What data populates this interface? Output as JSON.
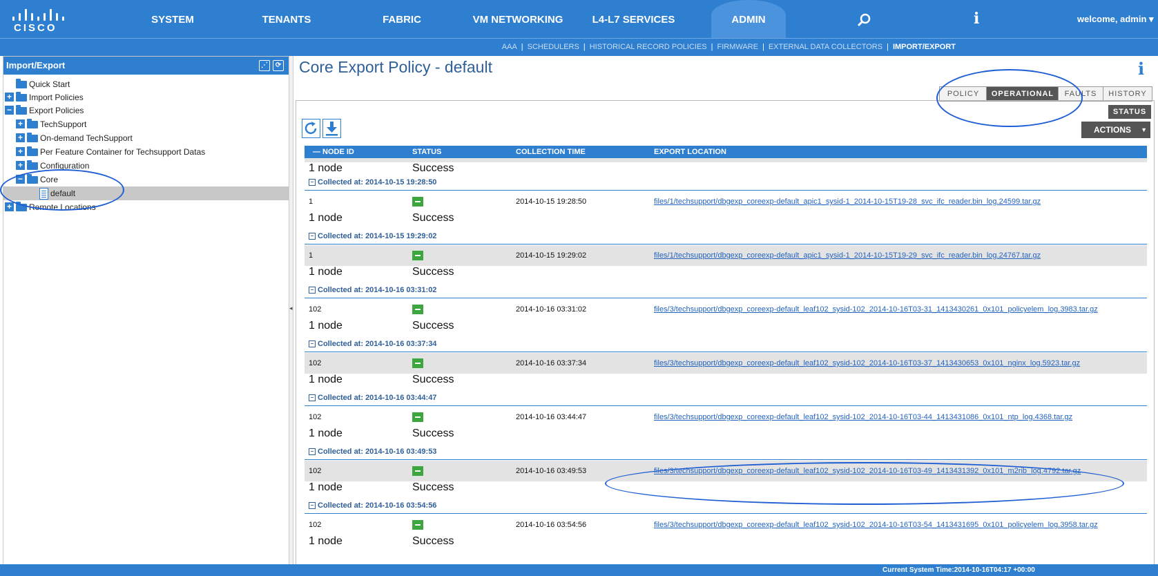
{
  "brand": "CISCO",
  "nav": [
    "SYSTEM",
    "TENANTS",
    "FABRIC",
    "VM NETWORKING",
    "L4-L7 SERVICES",
    "ADMIN"
  ],
  "welcome": "welcome, admin ▾",
  "subnav": [
    "AAA",
    "SCHEDULERS",
    "HISTORICAL RECORD POLICIES",
    "FIRMWARE",
    "EXTERNAL DATA COLLECTORS",
    "IMPORT/EXPORT"
  ],
  "left_panel": {
    "title": "Import/Export",
    "tree": [
      "Quick Start",
      "Import Policies",
      "Export Policies",
      "TechSupport",
      "On-demand TechSupport",
      "Per Feature Container for Techsupport Datas",
      "Configuration",
      "Core",
      "default",
      "Remote Locations"
    ]
  },
  "page_title": "Core Export Policy - default",
  "tabs": [
    "POLICY",
    "OPERATIONAL",
    "FAULTS",
    "HISTORY"
  ],
  "status_tab": "STATUS",
  "actions_label": "ACTIONS",
  "columns": [
    "NODE ID",
    "STATUS",
    "COLLECTION TIME",
    "EXPORT LOCATION"
  ],
  "top_partial": {
    "big_node": "1 node",
    "big_status": "Success"
  },
  "groups": [
    {
      "collected": "Collected at: 2014-10-15 19:28:50",
      "node": "1",
      "time": "2014-10-15 19:28:50",
      "location": "files/1/techsupport/dbgexp_coreexp-default_apic1_sysid-1_2014-10-15T19-28_svc_ifc_reader.bin_log.24599.tar.gz",
      "big_node": "1 node",
      "big_status": "Success"
    },
    {
      "collected": "Collected at: 2014-10-15 19:29:02",
      "node": "1",
      "time": "2014-10-15 19:29:02",
      "location": "files/1/techsupport/dbgexp_coreexp-default_apic1_sysid-1_2014-10-15T19-29_svc_ifc_reader.bin_log.24767.tar.gz",
      "big_node": "1 node",
      "big_status": "Success"
    },
    {
      "collected": "Collected at: 2014-10-16 03:31:02",
      "node": "102",
      "time": "2014-10-16 03:31:02",
      "location": "files/3/techsupport/dbgexp_coreexp-default_leaf102_sysid-102_2014-10-16T03-31_1413430261_0x101_policyelem_log.3983.tar.gz",
      "big_node": "1 node",
      "big_status": "Success"
    },
    {
      "collected": "Collected at: 2014-10-16 03:37:34",
      "node": "102",
      "time": "2014-10-16 03:37:34",
      "location": "files/3/techsupport/dbgexp_coreexp-default_leaf102_sysid-102_2014-10-16T03-37_1413430653_0x101_nginx_log.5923.tar.gz",
      "big_node": "1 node",
      "big_status": "Success"
    },
    {
      "collected": "Collected at: 2014-10-16 03:44:47",
      "node": "102",
      "time": "2014-10-16 03:44:47",
      "location": "files/3/techsupport/dbgexp_coreexp-default_leaf102_sysid-102_2014-10-16T03-44_1413431086_0x101_ntp_log.4368.tar.gz",
      "big_node": "1 node",
      "big_status": "Success"
    },
    {
      "collected": "Collected at: 2014-10-16 03:49:53",
      "node": "102",
      "time": "2014-10-16 03:49:53",
      "location": "files/3/techsupport/dbgexp_coreexp-default_leaf102_sysid-102_2014-10-16T03-49_1413431392_0x101_m2rib_log.4792.tar.gz",
      "big_node": "1 node",
      "big_status": "Success"
    },
    {
      "collected": "Collected at: 2014-10-16 03:54:56",
      "node": "102",
      "time": "2014-10-16 03:54:56",
      "location": "files/3/techsupport/dbgexp_coreexp-default_leaf102_sysid-102_2014-10-16T03-54_1413431695_0x101_policyelem_log.3958.tar.gz",
      "big_node": "1 node",
      "big_status": "Success"
    }
  ],
  "system_time": "Current System Time:2014-10-16T04:17 +00:00",
  "colors": {
    "brand_blue": "#2f7fd0",
    "status_green": "#3ea63e",
    "link": "#2364c0",
    "annotation": "#1f5fd3"
  }
}
